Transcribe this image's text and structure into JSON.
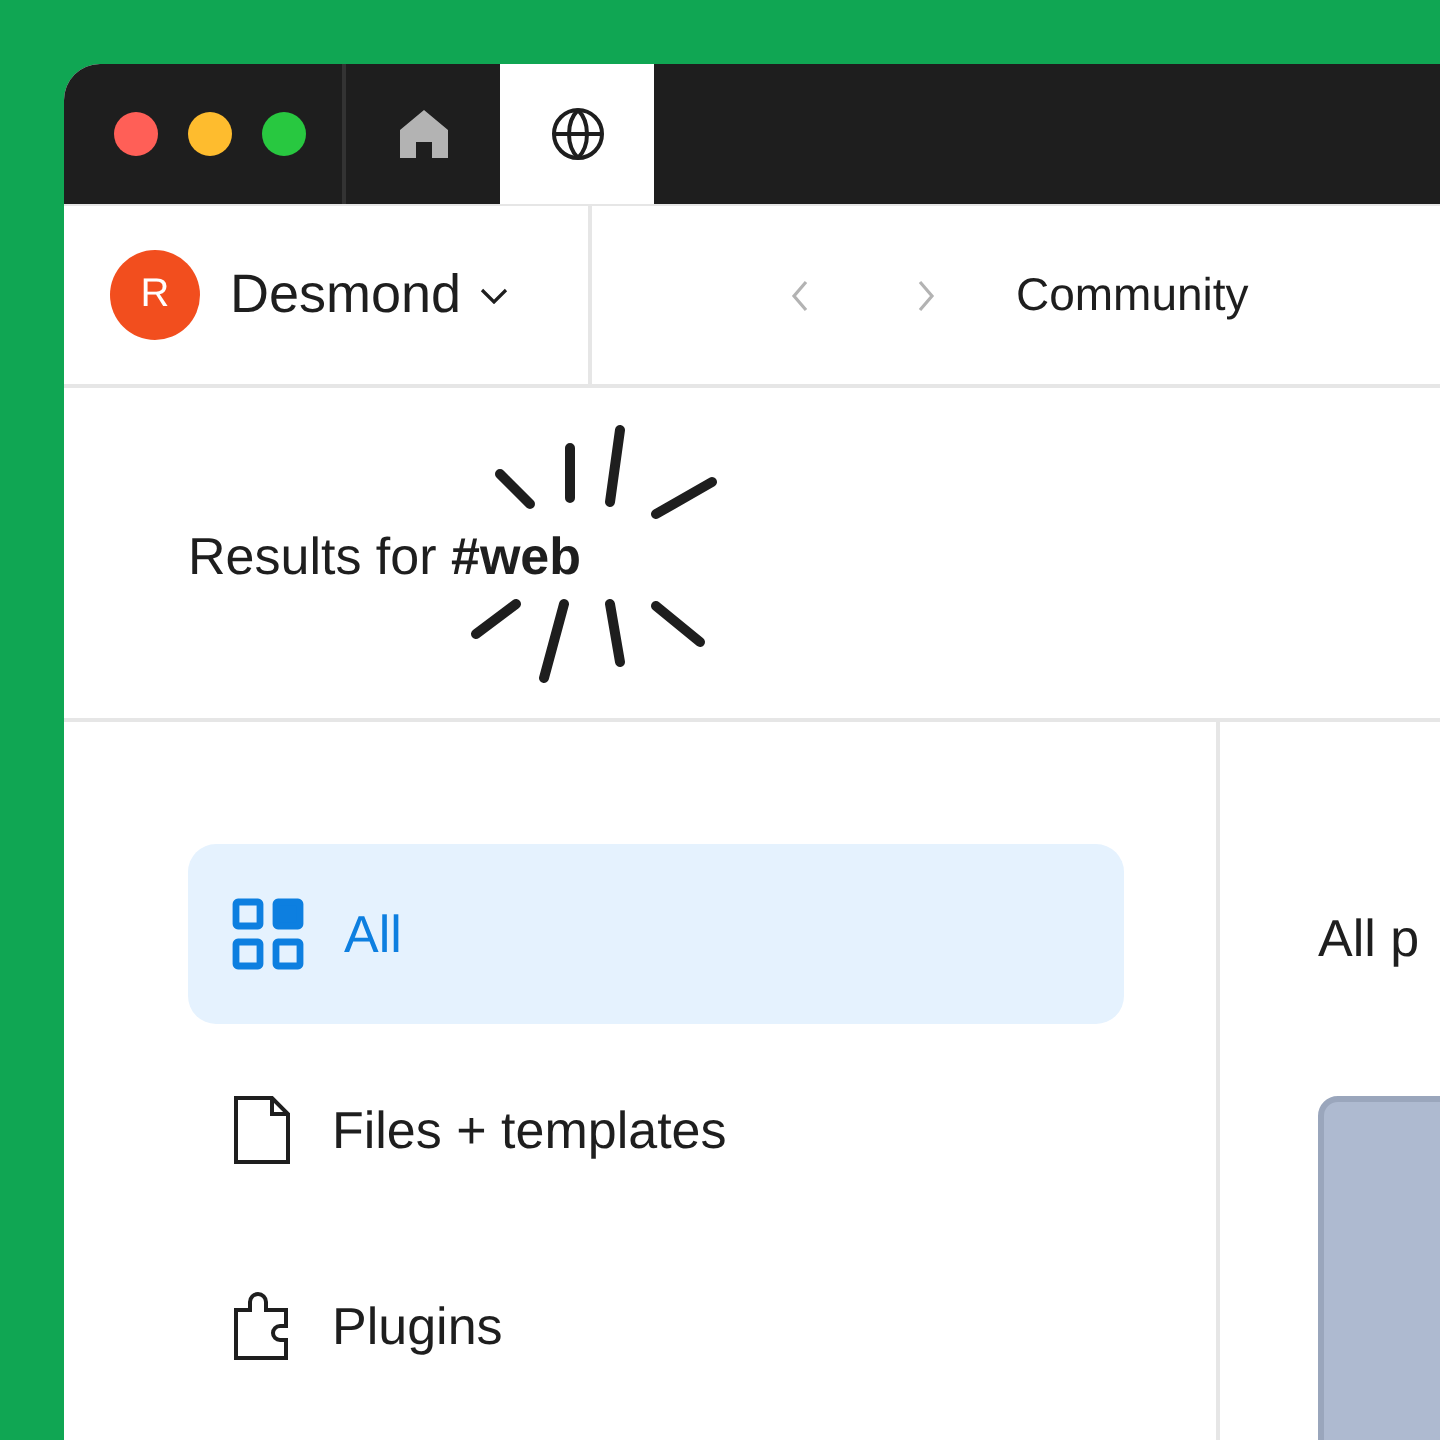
{
  "window": {
    "controls": [
      {
        "kind": "close"
      },
      {
        "kind": "minimize"
      },
      {
        "kind": "zoom"
      }
    ]
  },
  "tabs": [
    {
      "kind": "home",
      "selected": false
    },
    {
      "kind": "globe",
      "selected": true
    }
  ],
  "account": {
    "initial": "R",
    "name": "Desmond"
  },
  "breadcrumb": {
    "title": "Community"
  },
  "results_title": "Results for **#web**",
  "sidebar": {
    "items": [
      {
        "kind": "all",
        "label": "All",
        "selected": true
      },
      {
        "kind": "file",
        "label": "Files + templates",
        "selected": false
      },
      {
        "kind": "plugin",
        "label": "Plugins",
        "selected": false
      }
    ]
  },
  "content": {
    "heading": "All p"
  }
}
